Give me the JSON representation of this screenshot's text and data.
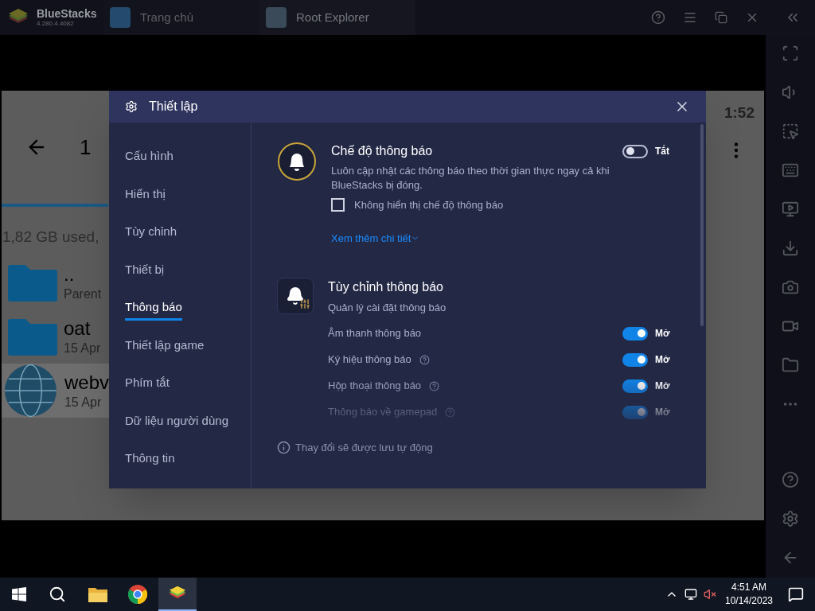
{
  "titlebar": {
    "app_name": "BlueStacks",
    "version": "4.280.4.4082",
    "tabs": [
      {
        "label": "Trang chủ",
        "selected": false
      },
      {
        "label": "Root Explorer",
        "selected": true
      }
    ]
  },
  "android": {
    "title": "1",
    "time": "1:52",
    "storage": "1,82 GB used,",
    "files": [
      {
        "kind": "folder",
        "name": "..",
        "detail": "Parent",
        "selected": false
      },
      {
        "kind": "folder",
        "name": "oat",
        "detail": "15 Apr",
        "selected": false
      },
      {
        "kind": "globe",
        "name": "webv",
        "detail": "15 Apr",
        "selected": true
      }
    ]
  },
  "settings": {
    "title": "Thiết lập",
    "nav": [
      {
        "label": "Cấu hình",
        "selected": false
      },
      {
        "label": "Hiển thị",
        "selected": false
      },
      {
        "label": "Tùy chỉnh",
        "selected": false
      },
      {
        "label": "Thiết bị",
        "selected": false
      },
      {
        "label": "Thông báo",
        "selected": true
      },
      {
        "label": "Thiết lập game",
        "selected": false
      },
      {
        "label": "Phím tắt",
        "selected": false
      },
      {
        "label": "Dữ liệu người dùng",
        "selected": false
      },
      {
        "label": "Thông tin",
        "selected": false
      }
    ],
    "mode": {
      "title": "Chế độ thông báo",
      "description": "Luôn cập nhật các thông báo theo thời gian thực ngay cả khi BlueStacks bị đóng.",
      "on": false,
      "state_label": "Tắt",
      "checkbox": {
        "label": "Không hiển thị chế độ thông báo",
        "checked": false
      },
      "more_link": "Xem thêm chi tiết"
    },
    "custom": {
      "title": "Tùy chỉnh thông báo",
      "subtitle": "Quản lý cài đặt thông báo",
      "options": [
        {
          "label": "Âm thanh thông báo",
          "help": false,
          "on": true,
          "state_label": "Mở"
        },
        {
          "label": "Ký hiệu thông báo",
          "help": true,
          "on": true,
          "state_label": "Mở"
        },
        {
          "label": "Hộp thoại thông báo",
          "help": true,
          "on": true,
          "state_label": "Mở"
        },
        {
          "label": "Thông báo về gamepad",
          "help": true,
          "on": true,
          "state_label": "Mở"
        }
      ]
    },
    "footer_note": "Thay đổi sẽ được lưu tự động"
  },
  "taskbar": {
    "time": "4:51 AM",
    "date": "10/14/2023"
  }
}
